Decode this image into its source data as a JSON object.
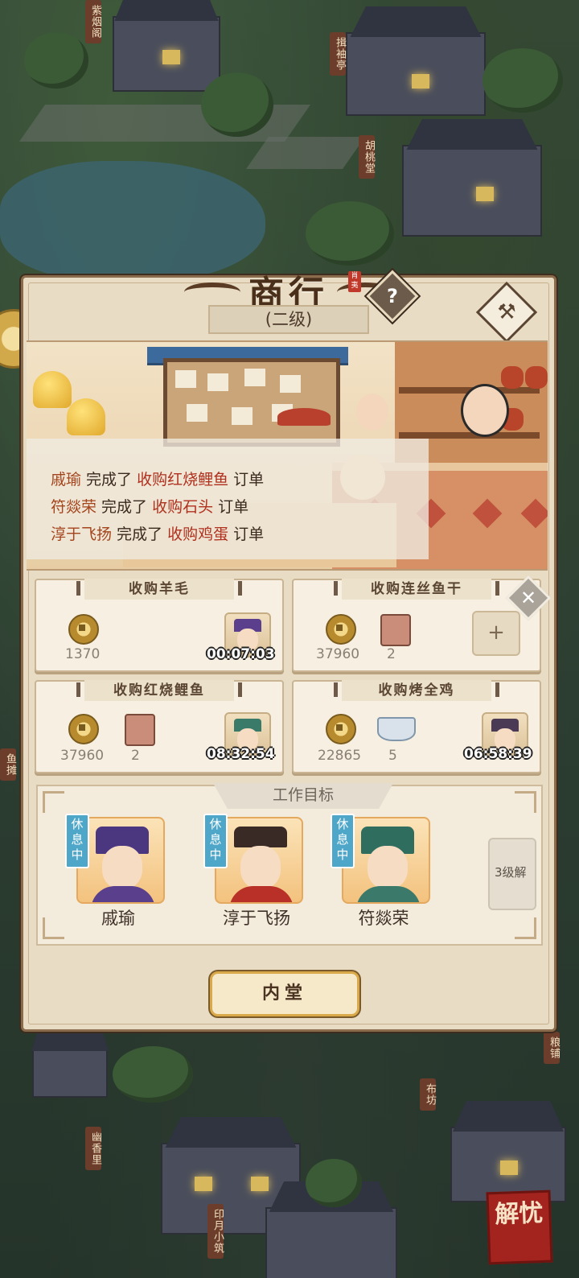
{
  "map": {
    "signs": [
      "紫烟阁",
      "揖袖亭",
      "胡桃堂",
      "粮铺",
      "布坊",
      "幽香里",
      "印月小筑",
      "鱼摊"
    ]
  },
  "panel": {
    "title": "商行",
    "title_stamp": "肖夷",
    "level": "(二级)",
    "help_icon": "question-icon",
    "build_icon": "hammer-icon",
    "log": [
      {
        "name": "戚瑜",
        "verb": " 完成了 ",
        "order": "收购红烧鲤鱼",
        "tail": " 订单"
      },
      {
        "name": "符燚荣",
        "verb": " 完成了 ",
        "order": "收购石头",
        "tail": " 订单"
      },
      {
        "name": "淳于飞扬",
        "verb": " 完成了 ",
        "order": "收购鸡蛋",
        "tail": " 订单"
      }
    ],
    "orders": [
      {
        "title": "收购羊毛",
        "coins": "1370",
        "timer": "00:07:03"
      },
      {
        "title": "收购连丝鱼干",
        "coins": "37960",
        "item_count": "2",
        "plus": "+"
      },
      {
        "title": "收购红烧鲤鱼",
        "coins": "37960",
        "item_count": "2",
        "timer": "08:32:54"
      },
      {
        "title": "收购烤全鸡",
        "coins": "22865",
        "item_count": "5",
        "timer": "06:58:39"
      }
    ],
    "close_label": "✕",
    "work": {
      "title": "工作目标",
      "workers": [
        {
          "name": "戚瑜",
          "status": "休息中"
        },
        {
          "name": "淳于飞扬",
          "status": "休息中"
        },
        {
          "name": "符燚荣",
          "status": "休息中"
        }
      ],
      "locked_label": "3级解"
    },
    "inner_button": "内堂"
  },
  "stamp": "解忧",
  "colors": {
    "accent_red": "#b0301e",
    "name_orange": "#a3441c",
    "rest_blue": "#4ea6c8",
    "gold": "#d9a94a"
  }
}
